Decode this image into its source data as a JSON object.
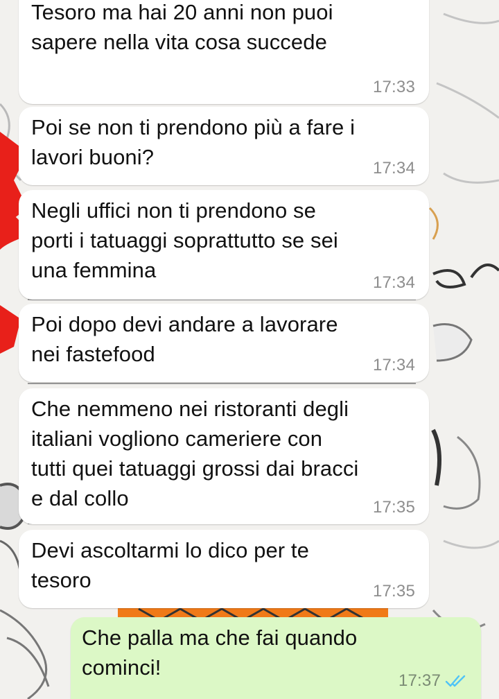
{
  "colors": {
    "incoming_bubble": "#ffffff",
    "outgoing_bubble": "#dcf8c6",
    "read_ticks": "#4fc3f7",
    "timestamp": "#8d8d8d"
  },
  "messages": [
    {
      "direction": "incoming",
      "text": "Tesoro ma hai 20 anni non puoi\nsapere nella vita cosa succede",
      "time": "17:33"
    },
    {
      "direction": "incoming",
      "text": "Poi se non ti prendono più a fare i\nlavori buoni?",
      "time": "17:34"
    },
    {
      "direction": "incoming",
      "text": "Negli uffici non ti prendono se\nporti i tatuaggi soprattutto se sei\nuna femmina",
      "time": "17:34"
    },
    {
      "direction": "incoming",
      "text": "Poi dopo devi andare a lavorare\nnei fastefood",
      "time": "17:34"
    },
    {
      "direction": "incoming",
      "text": "Che nemmeno nei ristoranti degli\nitaliani vogliono cameriere con\ntutti quei tatuaggi grossi dai bracci\ne dal collo",
      "time": "17:35"
    },
    {
      "direction": "incoming",
      "text": "Devi ascoltarmi lo dico per te\ntesoro",
      "time": "17:35"
    },
    {
      "direction": "outgoing",
      "text": "Che palla ma che fai quando\ncominci!",
      "time": "17:37",
      "status_icon": "double-check-read-icon"
    }
  ]
}
